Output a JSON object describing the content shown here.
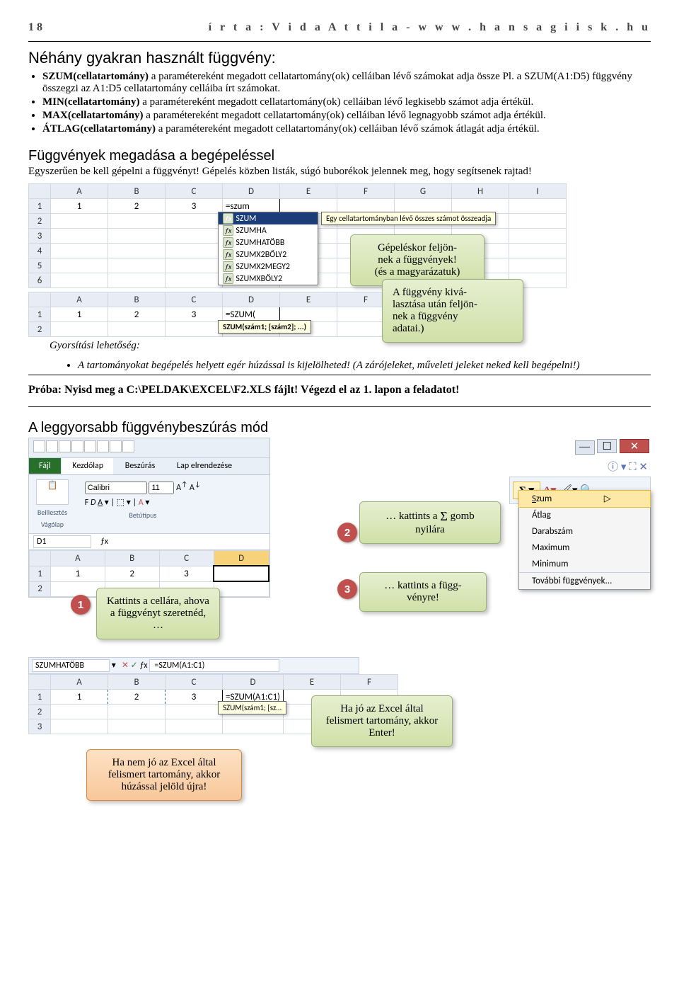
{
  "header": {
    "page_num": "18",
    "byline": "í r t a : V i d a   A t t i l a   -   w w w . h a n s a g i i s k . h u"
  },
  "section1": {
    "title": "Néhány gyakran használt függvény:",
    "items": [
      {
        "bold": "SZUM(cellatartomány)",
        "text": " a paramétereként megadott cellatartomány(ok) celláiban lévő számokat adja össze Pl. a SZUM(A1:D5) függvény összegzi az A1:D5 cellatartomány celláiba írt számokat."
      },
      {
        "bold": "MIN(cellatartomány)",
        "text": " a paramétereként megadott cellatartomány(ok) celláiban lévő legkisebb számot adja értékül."
      },
      {
        "bold": "MAX(cellatartomány)",
        "text": " a paramétereként megadott cellatartomány(ok) celláiban lévő legnagyobb számot adja értékül."
      },
      {
        "bold": "ÁTLAG(cellatartomány)",
        "text": " a paramétereként megadott cellatartomány(ok) celláiban lévő számok átlagát adja értékül."
      }
    ]
  },
  "section2": {
    "heading": "Függvények megadása a begépeléssel",
    "subtitle": "Egyszerűen be kell gépelni a függvényt! Gépelés közben listák, súgó buborékok jelennek meg, hogy segítsenek rajtad!",
    "sheet1": {
      "cols": [
        "A",
        "B",
        "C",
        "D",
        "E",
        "F",
        "G",
        "H",
        "I"
      ],
      "rows": [
        "1",
        "2",
        "3",
        "4",
        "5",
        "6"
      ],
      "cell_a1": "1",
      "cell_b1": "2",
      "cell_c1": "3",
      "cell_d1": "=szum",
      "dropdown_items": [
        "SZUM",
        "SZUMHA",
        "SZUMHATÖBB",
        "SZUMX2BŐLY2",
        "SZUMX2MEGY2",
        "SZUMXBŐLY2"
      ],
      "tooltip": "Egy cellatartományban lévő összes számot összeadja"
    },
    "callout1a": "Gépeléskor feljön-",
    "callout1b": "nek a függvények!",
    "callout1c": "(és a magyarázatuk)",
    "sheet2": {
      "cols": [
        "A",
        "B",
        "C",
        "D",
        "E",
        "F"
      ],
      "rows": [
        "1",
        "2"
      ],
      "cell_a1": "1",
      "cell_b1": "2",
      "cell_c1": "3",
      "cell_d1": "=SZUM(",
      "hint": "SZUM(szám1; [szám2]; ...)"
    },
    "callout2a": "A függvény kivá-",
    "callout2b": "lasztása után feljön-",
    "callout2c": "nek a függvény",
    "callout2d": "adatai.)",
    "gyors_label": "Gyorsítási lehetőség:",
    "gyors_item": "A tartományokat begépelés helyett egér húzással is kijelölheted! (A zárójeleket, műveleti jeleket neked kell begépelni!)"
  },
  "proba": "Próba: Nyisd meg a C:\\PELDAK\\EXCEL\\F2.XLS fájlt! Végezd el az 1. lapon a feladatot!",
  "section3": {
    "heading": "A leggyorsabb függvénybeszúrás mód",
    "tabs": {
      "file": "Fájl",
      "home": "Kezdőlap",
      "insert": "Beszúrás",
      "layout": "Lap elrendezése"
    },
    "font_name": "Calibri",
    "font_size": "11",
    "clipboard_label": "Beillesztés",
    "group_vago": "Vágólap",
    "group_font": "Betűtípus",
    "cellref": "D1",
    "fx": "ƒx",
    "cols": [
      "A",
      "B",
      "C",
      "D"
    ],
    "rows": [
      "1",
      "2"
    ],
    "a1": "1",
    "b1": "2",
    "c1": "3",
    "menu": {
      "title": "Σ ▾",
      "items": [
        "Szum",
        "Átlag",
        "Darabszám",
        "Maximum",
        "Minimum",
        "További függvények..."
      ]
    },
    "callout1": "Kattints a cellára, ahova a függvényt szeretnéd, …",
    "callout2_pre": "… kattints a ",
    "callout2_sigma": "Σ",
    "callout2_post": " gomb nyilára",
    "callout3": "… kattints a függ-\nvényre!",
    "badge1": "1",
    "badge2": "2",
    "badge3": "3"
  },
  "section4": {
    "namebox": "SZUMHATÖBB",
    "fx": "ƒx",
    "formula": "=SZUM(A1:C1)",
    "cols": [
      "A",
      "B",
      "C",
      "D",
      "E",
      "F"
    ],
    "rows": [
      "1",
      "2",
      "3"
    ],
    "a1": "1",
    "b1": "2",
    "c1": "3",
    "d1": "=SZUM(A1:C1)",
    "hint": "SZUM(szám1; [sz…",
    "callout_green": "Ha jó az Excel által felismert tartomány, akkor Enter!",
    "callout_red": "Ha nem jó az Excel által felismert tartomány, akkor húzással jelöld újra!"
  }
}
